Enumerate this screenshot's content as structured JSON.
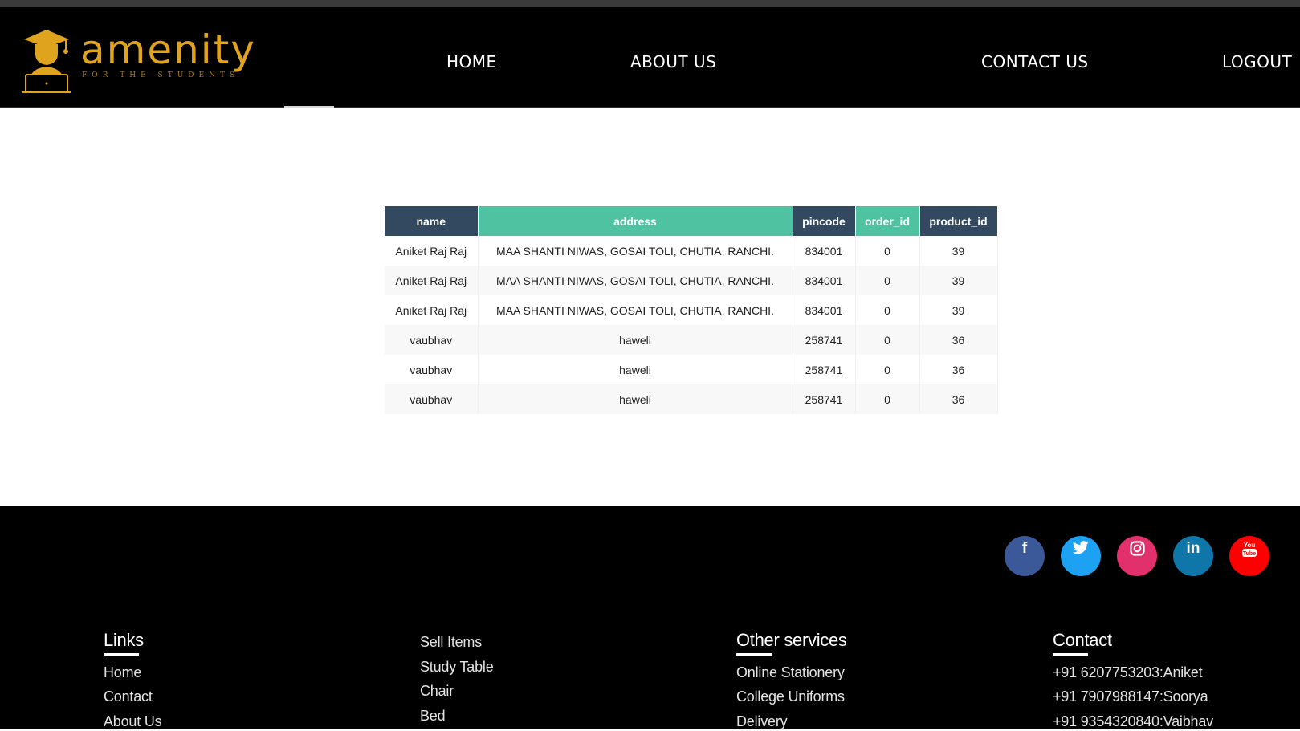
{
  "brand": {
    "name": "amenity",
    "tagline": "FOR THE STUDENTS"
  },
  "nav": {
    "home": "HOME",
    "about": "ABOUT US",
    "contact": "CONTACT US",
    "logout": "LOGOUT"
  },
  "table": {
    "headers": [
      "name",
      "address",
      "pincode",
      "order_id",
      "product_id"
    ],
    "rows": [
      [
        "Aniket Raj Raj",
        "MAA SHANTI NIWAS, GOSAI TOLI, CHUTIA, RANCHI.",
        "834001",
        "0",
        "39"
      ],
      [
        "Aniket Raj Raj",
        "MAA SHANTI NIWAS, GOSAI TOLI, CHUTIA, RANCHI.",
        "834001",
        "0",
        "39"
      ],
      [
        "Aniket Raj Raj",
        "MAA SHANTI NIWAS, GOSAI TOLI, CHUTIA, RANCHI.",
        "834001",
        "0",
        "39"
      ],
      [
        "vaubhav",
        "haweli",
        "258741",
        "0",
        "36"
      ],
      [
        "vaubhav",
        "haweli",
        "258741",
        "0",
        "36"
      ],
      [
        "vaubhav",
        "haweli",
        "258741",
        "0",
        "36"
      ]
    ]
  },
  "social": {
    "facebook": {
      "glyph": "f",
      "color": "#3b5998",
      "icon": "facebook-icon"
    },
    "twitter": {
      "glyph": "🐦",
      "color": "#1da1f2",
      "icon": "twitter-icon"
    },
    "instagram": {
      "glyph": "◎",
      "color": "#e1306c",
      "icon": "instagram-icon"
    },
    "linkedin": {
      "glyph": "in",
      "color": "#0e76a8",
      "icon": "linkedin-icon"
    },
    "youtube": {
      "glyph": "▶",
      "color": "#ff0000",
      "icon": "youtube-icon"
    }
  },
  "footer": {
    "links": {
      "heading": "Links",
      "items": [
        "Home",
        "Contact",
        "About Us"
      ]
    },
    "sell": {
      "items": [
        "Sell Items",
        "Study Table",
        "Chair",
        "Bed"
      ]
    },
    "services": {
      "heading": "Other services",
      "items": [
        "Online Stationery",
        "College Uniforms",
        "Delivery"
      ]
    },
    "contact": {
      "heading": "Contact",
      "items": [
        "+91 6207753203:Aniket",
        "+91 7907988147:Soorya",
        "+91 9354320840:Vaibhav"
      ]
    }
  }
}
